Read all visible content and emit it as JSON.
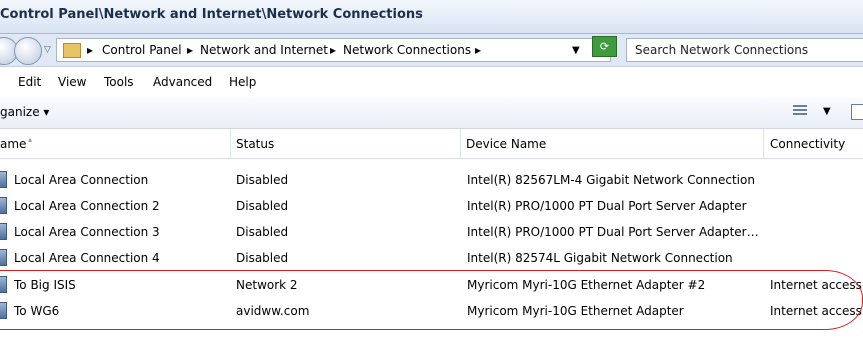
{
  "window": {
    "title": "Control Panel\\Network and Internet\\Network Connections"
  },
  "address_bar": {
    "crumbs": [
      "Control Panel",
      "Network and Internet",
      "Network Connections"
    ],
    "search_placeholder": "Search Network Connections"
  },
  "menubar": [
    "Edit",
    "View",
    "Tools",
    "Advanced",
    "Help"
  ],
  "toolbar": {
    "organize_label": "ganize ▾"
  },
  "columns": {
    "name": "ame",
    "status": "Status",
    "device": "Device Name",
    "connectivity": "Connectivity"
  },
  "rows": [
    {
      "name": "Local Area Connection",
      "status": "Disabled",
      "device": "Intel(R) 82567LM-4 Gigabit Network Connection",
      "connectivity": ""
    },
    {
      "name": "Local Area Connection 2",
      "status": "Disabled",
      "device": "Intel(R) PRO/1000 PT Dual Port Server Adapter",
      "connectivity": ""
    },
    {
      "name": "Local Area Connection 3",
      "status": "Disabled",
      "device": "Intel(R) PRO/1000 PT Dual Port Server Adapter…",
      "connectivity": ""
    },
    {
      "name": "Local Area Connection 4",
      "status": "Disabled",
      "device": "Intel(R) 82574L Gigabit Network Connection",
      "connectivity": ""
    },
    {
      "name": "To Big ISIS",
      "status": "Network  2",
      "device": "Myricom Myri-10G Ethernet Adapter #2",
      "connectivity": "Internet access"
    },
    {
      "name": "To WG6",
      "status": "avidww.com",
      "device": "Myricom Myri-10G Ethernet Adapter",
      "connectivity": "Internet access"
    }
  ],
  "colors": {
    "highlight": "#d81f1f",
    "header_bg": "#f3f7fc"
  }
}
